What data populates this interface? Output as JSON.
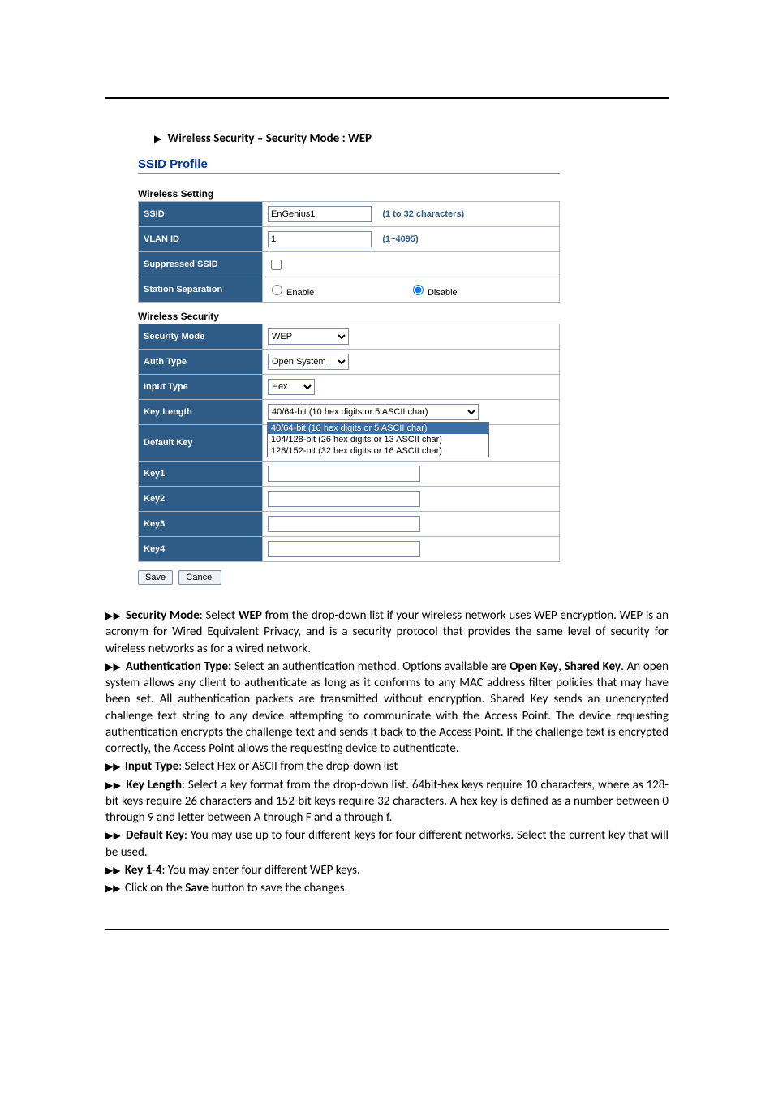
{
  "heading": {
    "arrow": "▶",
    "text": "Wireless Security – Security Mode : WEP"
  },
  "profile": {
    "title": "SSID Profile",
    "wireless_setting": {
      "header": "Wireless Setting",
      "rows": {
        "ssid": {
          "label": "SSID",
          "value": "EnGenius1",
          "note": "(1 to 32 characters)"
        },
        "vlanid": {
          "label": "VLAN ID",
          "value": "1",
          "note": "(1~4095)"
        },
        "suppressed": {
          "label": "Suppressed SSID",
          "checked": false
        },
        "separation": {
          "label": "Station Separation",
          "enable_label": "Enable",
          "disable_label": "Disable",
          "selected": "disable"
        }
      }
    },
    "wireless_security": {
      "header": "Wireless Security",
      "rows": {
        "security_mode": {
          "label": "Security Mode",
          "value": "WEP"
        },
        "auth_type": {
          "label": "Auth Type",
          "value": "Open System"
        },
        "input_type": {
          "label": "Input Type",
          "value": "Hex"
        },
        "key_length": {
          "label": "Key Length",
          "value": "40/64-bit (10 hex digits or 5 ASCII char)",
          "options": [
            "40/64-bit (10 hex digits or 5 ASCII char)",
            "104/128-bit (26 hex digits or 13 ASCII char)",
            "128/152-bit (32 hex digits or 16 ASCII char)"
          ]
        },
        "default_key": {
          "label": "Default Key"
        },
        "keys": [
          {
            "label": "Key1",
            "value": ""
          },
          {
            "label": "Key2",
            "value": ""
          },
          {
            "label": "Key3",
            "value": ""
          },
          {
            "label": "Key4",
            "value": ""
          }
        ]
      }
    },
    "buttons": {
      "save": "Save",
      "cancel": "Cancel"
    }
  },
  "desc": {
    "dbl_arrow": "▶▶",
    "p1_a": " Security Mode",
    "p1_b": ": Select ",
    "p1_c": "WEP",
    "p1_d": " from the drop-down list if your wireless network uses WEP encryption. WEP is an acronym for Wired Equivalent Privacy, and is a security protocol that provides the same level of security for wireless networks as for a wired network.",
    "p2_a": " Authentication Type:",
    "p2_b": " Select an authentication method. Options available are ",
    "p2_c": "Open Key",
    "p2_d": ", ",
    "p2_e": "Shared Key",
    "p2_f": ". An open system allows any client to authenticate as long as it conforms to any MAC address filter policies that may have been set. All authentication packets are transmitted without encryption. Shared Key sends an unencrypted challenge text string to any device attempting to communicate with the Access Point. The device requesting authentication encrypts the challenge text and sends it back to the Access Point. If the challenge text is encrypted correctly, the Access Point allows the requesting device to authenticate.",
    "p3_a": " Input Type",
    "p3_b": ": Select Hex or ASCII from the drop-down list",
    "p4_a": " Key Length",
    "p4_b": ": Select a key format from the drop-down list. 64bit-hex keys require 10 characters, where as 128-bit keys require 26 characters and 152-bit keys require 32 characters. A hex key is defined as a number between 0 through 9 and letter between A through F and a through f.",
    "p5_a": " Default Key",
    "p5_b": ": You may use up to four different keys for four different networks. Select the current key that will be used.",
    "p6_a": " Key 1-4",
    "p6_b": ": You may enter four different WEP keys.",
    "p7_a": " Click on the ",
    "p7_b": "Save",
    "p7_c": " button to save the changes."
  }
}
